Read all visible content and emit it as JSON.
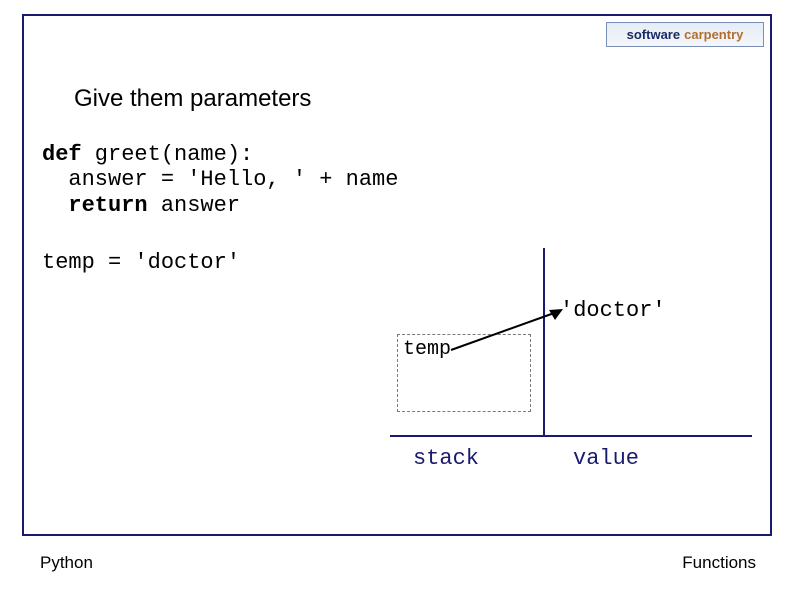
{
  "logo": {
    "left": "software",
    "right": "carpentry"
  },
  "heading": "Give them parameters",
  "code": {
    "kw_def": "def",
    "sig": " greet(name):",
    "body1": "  answer = 'Hello, ' + name",
    "kw_return": "return",
    "ret_rest": " answer"
  },
  "code2": "temp = 'doctor'",
  "diagram": {
    "value_literal": "'doctor'",
    "var_name": "temp",
    "col_stack": "stack",
    "col_value": "value"
  },
  "footer": {
    "left": "Python",
    "right": "Functions"
  }
}
